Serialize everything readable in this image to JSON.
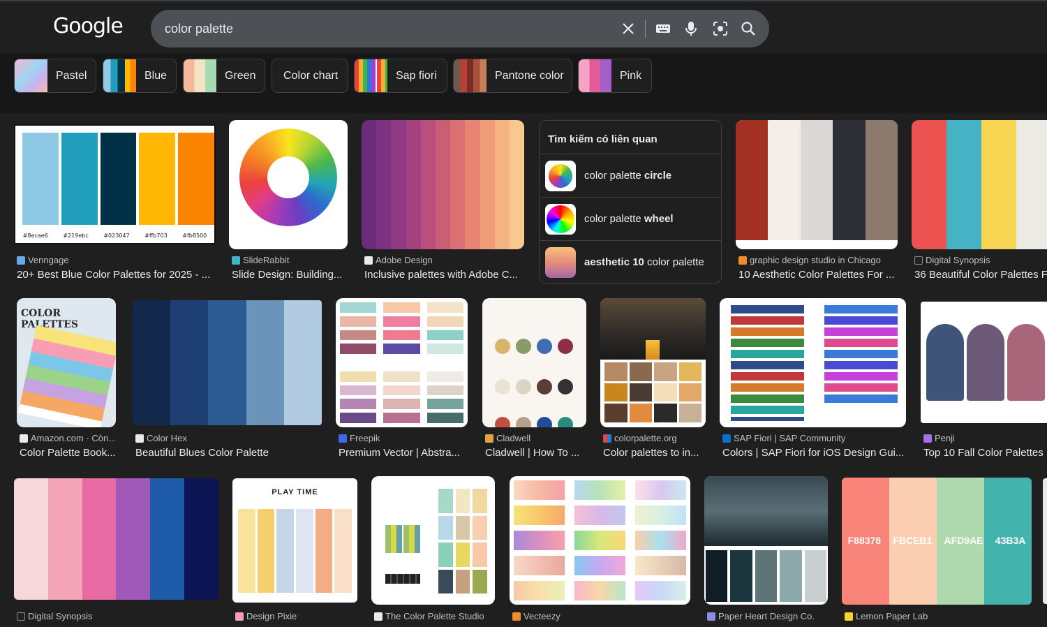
{
  "header": {
    "logo": "Google",
    "search_value": "color palette"
  },
  "chips": [
    {
      "label": "Pastel"
    },
    {
      "label": "Blue"
    },
    {
      "label": "Green"
    },
    {
      "label": "Color chart"
    },
    {
      "label": "Sap fiori"
    },
    {
      "label": "Pantone color"
    },
    {
      "label": "Pink"
    }
  ],
  "related": {
    "heading": "Tìm kiếm có liên quan",
    "items": [
      {
        "prefix": "color palette ",
        "bold": "circle",
        "suffix": ""
      },
      {
        "prefix": "color palette ",
        "bold": "wheel",
        "suffix": ""
      },
      {
        "prefix": "",
        "bold": "aesthetic 10",
        "suffix": " color palette"
      }
    ]
  },
  "results": [
    {
      "source": "Venngage",
      "title": "20+ Best Blue Color Palettes for 2025 - ...",
      "hex": [
        "#8ecae6",
        "#219ebc",
        "#023047",
        "#ffb703",
        "#fb8500"
      ]
    },
    {
      "source": "SlideRabbit",
      "title": "Slide Design: Building..."
    },
    {
      "source": "Adobe Design",
      "title": "Inclusive palettes with Adobe C..."
    },
    {
      "source": "graphic design studio in Chicago",
      "title": "10 Aesthetic Color Palettes For ..."
    },
    {
      "source": "Digital Synopsis",
      "title": "36 Beautiful Color Palettes F"
    },
    {
      "source": "Amazon.com · Còn...",
      "title": "Color Palette Book...",
      "img_text": "COLOR PALETTES"
    },
    {
      "source": "Color Hex",
      "title": "Beautiful Blues Color Palette"
    },
    {
      "source": "Freepik",
      "title": "Premium Vector | Abstra..."
    },
    {
      "source": "Cladwell",
      "title": "Cladwell | How To ..."
    },
    {
      "source": "colorpalette.org",
      "title": "Color palettes to in..."
    },
    {
      "source": "SAP Fiori | SAP Community",
      "title": "Colors | SAP Fiori for iOS Design Gui..."
    },
    {
      "source": "Penji",
      "title": "Top 10 Fall Color Palettes"
    },
    {
      "source": "Digital Synopsis",
      "title": ""
    },
    {
      "source": "Design Pixie",
      "title": "",
      "img_text": "PLAY TIME"
    },
    {
      "source": "The Color Palette Studio",
      "title": ""
    },
    {
      "source": "Vecteezy",
      "title": ""
    },
    {
      "source": "Paper Heart Design Co.",
      "title": ""
    },
    {
      "source": "Lemon Paper Lab",
      "title": "",
      "hex": [
        "F88378",
        "FBCEB1",
        "AFD9AE",
        "43B3A"
      ]
    }
  ],
  "colors": {
    "bg": "#1f1f1f",
    "searchbar": "#4d5156",
    "text": "#e8eaed",
    "muted": "#bdc1c6"
  }
}
